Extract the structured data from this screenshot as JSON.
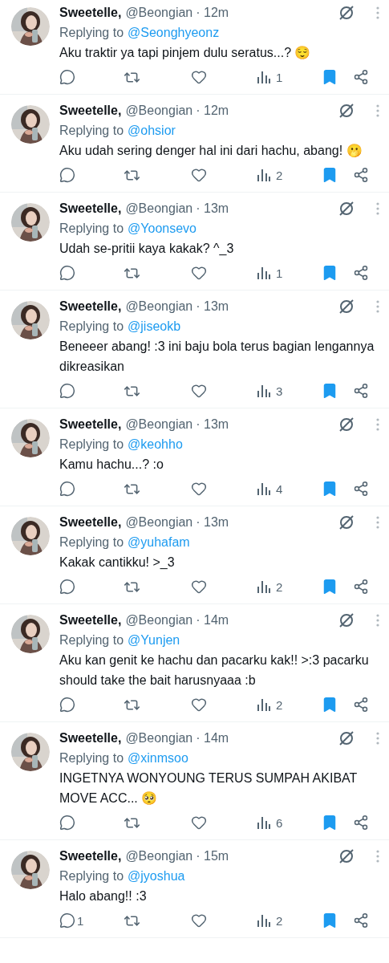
{
  "replies": [
    {
      "name": "Sweetelle,",
      "handle": "@Beongian",
      "time": "· 12m",
      "replying_label": "Replying to",
      "replying_to": "@Seonghyeonz",
      "text": "Aku traktir ya tapi pinjem dulu seratus...? 😌",
      "views": "1",
      "bookmarked": true
    },
    {
      "name": "Sweetelle,",
      "handle": "@Beongian",
      "time": "· 12m",
      "replying_label": "Replying to",
      "replying_to": "@ohsior",
      "text": "Aku udah sering denger hal ini dari hachu, abang! 🫢",
      "views": "2",
      "bookmarked": true
    },
    {
      "name": "Sweetelle,",
      "handle": "@Beongian",
      "time": "· 13m",
      "replying_label": "Replying to",
      "replying_to": "@Yoonsevo",
      "text": "Udah se-pritii kaya kakak? ^_3",
      "views": "1",
      "bookmarked": true
    },
    {
      "name": "Sweetelle,",
      "handle": "@Beongian",
      "time": "· 13m",
      "replying_label": "Replying to",
      "replying_to": "@jiseokb",
      "text": "Beneeer abang! :3 ini baju bola terus bagian lengannya dikreasikan",
      "views": "3",
      "bookmarked": true
    },
    {
      "name": "Sweetelle,",
      "handle": "@Beongian",
      "time": "· 13m",
      "replying_label": "Replying to",
      "replying_to": "@keohho",
      "text": "Kamu hachu...? :o",
      "views": "4",
      "bookmarked": true
    },
    {
      "name": "Sweetelle,",
      "handle": "@Beongian",
      "time": "· 13m",
      "replying_label": "Replying to",
      "replying_to": "@yuhafam",
      "text": "Kakak cantikku! >_3",
      "views": "2",
      "bookmarked": true
    },
    {
      "name": "Sweetelle,",
      "handle": "@Beongian",
      "time": "· 14m",
      "replying_label": "Replying to",
      "replying_to": "@Yunjen",
      "text": "Aku kan genit ke hachu dan pacarku kak!! >:3 pacarku should take the bait harusnyaaa :b",
      "views": "2",
      "bookmarked": true
    },
    {
      "name": "Sweetelle,",
      "handle": "@Beongian",
      "time": "· 14m",
      "replying_label": "Replying to",
      "replying_to": "@xinmsoo",
      "text": "INGETNYA WONYOUNG TERUS SUMPAH AKIBAT MOVE ACC... 🥺",
      "views": "6",
      "bookmarked": true
    },
    {
      "name": "Sweetelle,",
      "handle": "@Beongian",
      "time": "· 15m",
      "replying_label": "Replying to",
      "replying_to": "@jyoshua",
      "text": "Halo abang!! :3",
      "reply_count": "1",
      "views": "2",
      "bookmarked": true
    }
  ]
}
